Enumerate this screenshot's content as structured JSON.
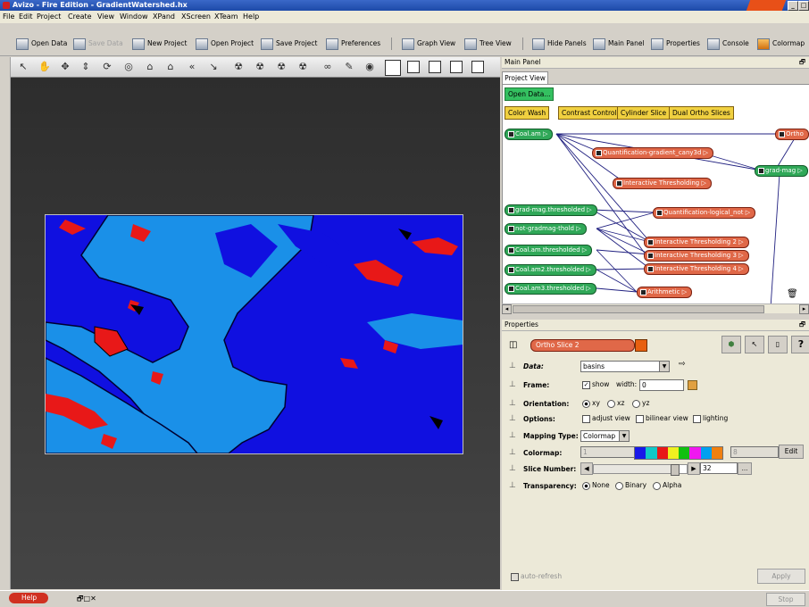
{
  "window": {
    "title": "Avizo - Fire Edition - GradientWatershed.hx"
  },
  "menu": [
    "File",
    "Edit",
    "Project",
    "Create",
    "View",
    "Window",
    "XPand",
    "XScreen",
    "XTeam",
    "Help"
  ],
  "toolbar": {
    "open_data": "Open Data",
    "save_data": "Save Data",
    "new_project": "New Project",
    "open_project": "Open Project",
    "save_project": "Save Project",
    "preferences": "Preferences",
    "graph_view": "Graph View",
    "tree_view": "Tree View",
    "hide_panels": "Hide Panels",
    "main_panel": "Main Panel",
    "properties": "Properties",
    "console": "Console",
    "colormap": "Colormap"
  },
  "main_panel": {
    "header": "Main Panel",
    "tab": "Project View",
    "open_data_btn": "Open Data...",
    "quick_buttons": [
      "Color Wash",
      "Contrast Control",
      "Cylinder Slice",
      "Dual Ortho Slices"
    ],
    "nodes_green": [
      "Coal.am",
      "grad-mag.thresholded",
      "not-gradmag-thold",
      "Coal.am.thresholded",
      "Coal.am2.thresholded",
      "Coal.am3.thresholded",
      "grad-mag"
    ],
    "nodes_red": [
      "Quantification-gradient_cany3d",
      "Interactive Thresholding",
      "Quantification-logical_not",
      "Interactive Thresholding 2",
      "Interactive Thresholding 3",
      "Interactive Thresholding 4",
      "Arithmetic",
      "Ortho"
    ]
  },
  "properties": {
    "header": "Properties",
    "module_name": "Ortho Slice 2",
    "data_label": "Data:",
    "data_value": "basins",
    "frame_label": "Frame:",
    "frame_show": "show",
    "frame_width_label": "width:",
    "frame_width": "0",
    "orientation_label": "Orientation:",
    "orientation_opts": [
      "xy",
      "xz",
      "yz"
    ],
    "options_label": "Options:",
    "options": [
      "adjust view",
      "bilinear view",
      "lighting"
    ],
    "mapping_label": "Mapping Type:",
    "mapping_value": "Colormap",
    "colormap_label": "Colormap:",
    "colormap_min": "1",
    "colormap_max": "8",
    "colormap_edit": "Edit",
    "colormap_colors": [
      "#1818e8",
      "#10c8c8",
      "#e81818",
      "#f0f020",
      "#10c010",
      "#f018f0",
      "#00a0f0",
      "#f08010"
    ],
    "slice_label": "Slice Number:",
    "slice_value": "32",
    "slice_fraction": 0.91,
    "slice_more": "...",
    "transparency_label": "Transparency:",
    "transparency_opts": [
      "None",
      "Binary",
      "Alpha"
    ],
    "auto_refresh": "auto-refresh",
    "apply": "Apply"
  },
  "status": {
    "help": "Help",
    "stop": "Stop"
  }
}
